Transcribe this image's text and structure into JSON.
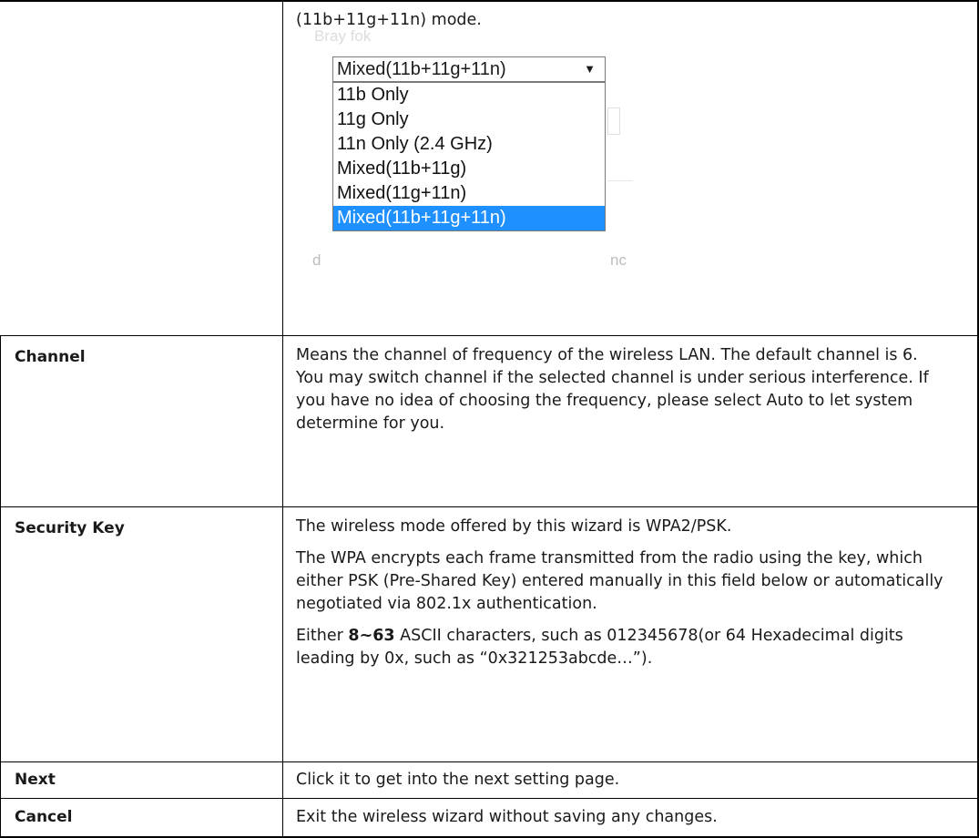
{
  "top_row": {
    "intro_text": "(11b+11g+11n) mode.",
    "screenshot": {
      "ghost_top": "Bray fok",
      "ghost_left": "d",
      "ghost_right": "nc",
      "select_value": "Mixed(11b+11g+11n)",
      "select_arrow": "▼",
      "options": [
        "11b Only",
        "11g Only",
        "11n Only (2.4 GHz)",
        "Mixed(11b+11g)",
        "Mixed(11g+11n)",
        "Mixed(11b+11g+11n)"
      ],
      "selected_index": 5,
      "selected_color": "#1e90ff"
    }
  },
  "rows": [
    {
      "label": "Channel",
      "paragraphs": [
        "Means the channel of frequency of the wireless LAN. The default channel is 6. You may switch channel if the selected channel is under serious interference. If you have no idea of choosing the frequency, please select Auto to let system determine for you."
      ]
    },
    {
      "label": "Security Key",
      "paragraphs": [
        "The wireless mode offered by this wizard is WPA2/PSK.",
        "The WPA encrypts each frame transmitted from the radio using the key, which either PSK (Pre-Shared Key) entered manually in this field below or automatically negotiated via 802.1x authentication."
      ],
      "p3_before": "Either ",
      "p3_bold": "8~63",
      "p3_after": " ASCII characters, such as 012345678(or 64 Hexadecimal digits leading by 0x, such as “0x321253abcde…”)."
    },
    {
      "label": "Next",
      "paragraphs": [
        "Click it to get into the next setting page."
      ]
    },
    {
      "label": "Cancel",
      "paragraphs": [
        "Exit the wireless wizard without saving any changes."
      ]
    }
  ]
}
